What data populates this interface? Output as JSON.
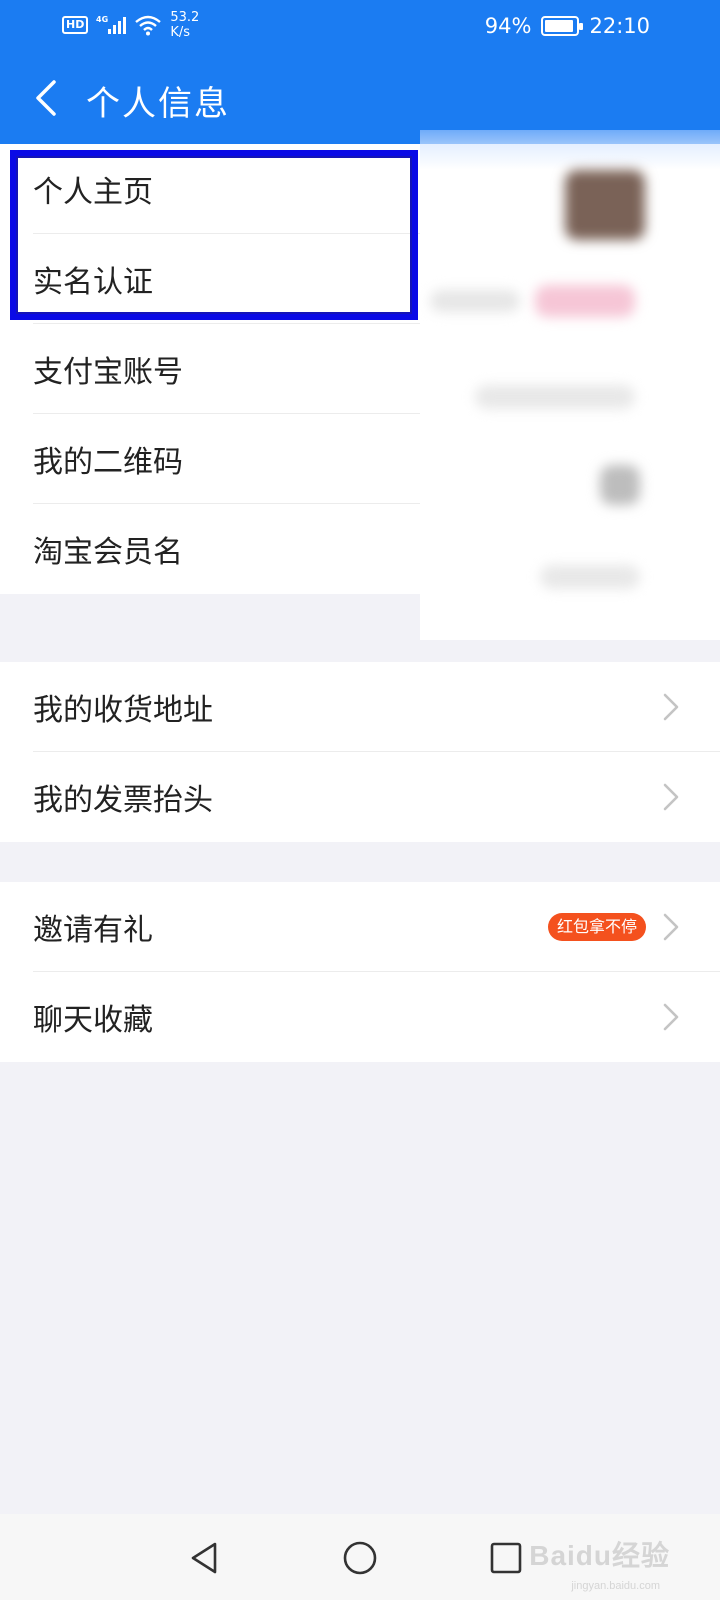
{
  "status_bar": {
    "hd": "HD",
    "network": "4G",
    "speed_value": "53.2",
    "speed_unit": "K/s",
    "battery_percent": "94%",
    "battery_level": 0.94,
    "time": "22:10"
  },
  "header": {
    "title": "个人信息",
    "back_icon": "chevron-left-icon"
  },
  "section1": {
    "items": [
      {
        "label": "个人主页"
      },
      {
        "label": "实名认证"
      },
      {
        "label": "支付宝账号"
      },
      {
        "label": "我的二维码"
      },
      {
        "label": "淘宝会员名"
      }
    ]
  },
  "section2": {
    "items": [
      {
        "label": "我的收货地址"
      },
      {
        "label": "我的发票抬头"
      }
    ]
  },
  "section3": {
    "items": [
      {
        "label": "邀请有礼",
        "badge": "红包拿不停"
      },
      {
        "label": "聊天收藏"
      }
    ]
  },
  "nav": {
    "back": "triangle-back-icon",
    "home": "circle-home-icon",
    "recents": "square-recents-icon"
  },
  "watermark": {
    "text": "Baidu经验",
    "sub": "jingyan.baidu.com"
  },
  "colors": {
    "header_blue": "#1b7cf2",
    "highlight_blue": "#0a0ae6",
    "badge_orange": "#f4511e",
    "background": "#f2f2f7"
  }
}
